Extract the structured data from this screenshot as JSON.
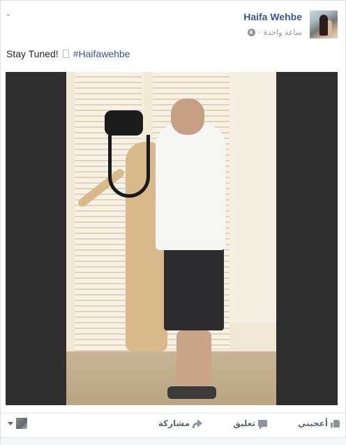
{
  "post": {
    "author": "Haifa Wehbe",
    "timestamp": "ساعة واحدة",
    "separator": "·",
    "privacy_icon": "globe-icon",
    "text_main": "Stay Tuned!",
    "emoji_placeholder": "",
    "hashtag": "#Haifawehbe"
  },
  "actions": {
    "like_label": "أعجبني",
    "comment_label": "تعليق",
    "share_label": "مشاركة"
  },
  "colors": {
    "link": "#365899",
    "meta": "#90949c",
    "action": "#606770"
  }
}
